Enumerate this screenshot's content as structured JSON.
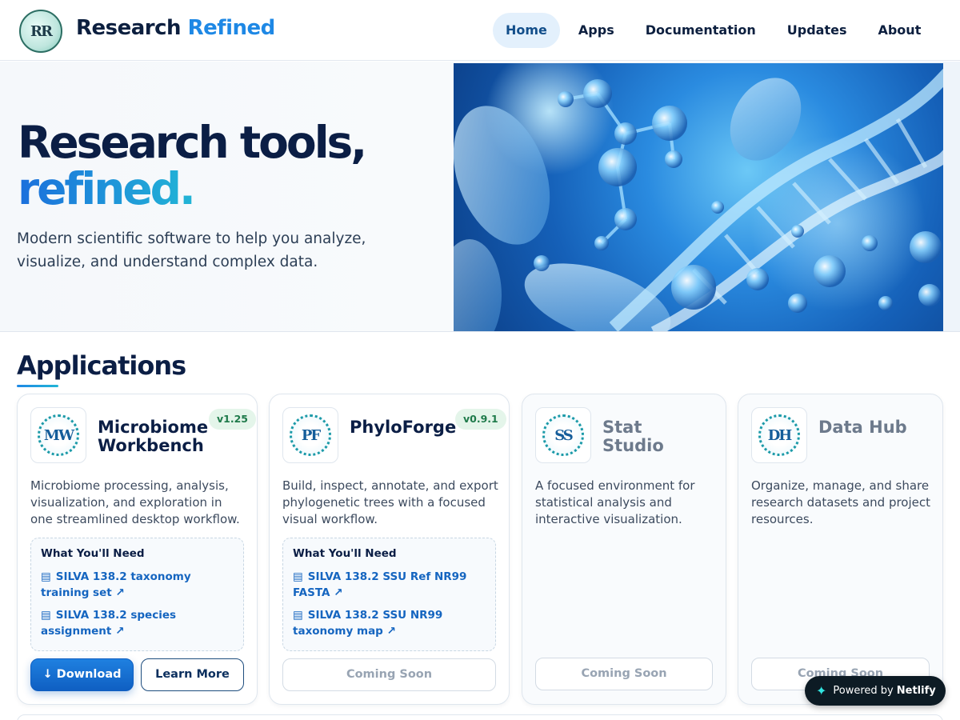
{
  "header": {
    "logo_text": "RR",
    "brand_main": "Research",
    "brand_accent": "Refined",
    "nav": [
      {
        "label": "Home",
        "active": true
      },
      {
        "label": "Apps",
        "active": false
      },
      {
        "label": "Documentation",
        "active": false
      },
      {
        "label": "Updates",
        "active": false
      },
      {
        "label": "About",
        "active": false
      }
    ]
  },
  "hero": {
    "title_line1": "Research tools,",
    "title_line2": "refined.",
    "subtitle": "Modern scientific software to help you analyze, visualize, and understand complex data."
  },
  "applications": {
    "title": "Applications",
    "cards": [
      {
        "icon_text": "MW",
        "name": "Microbiome Workbench",
        "version": "v1.25",
        "description": "Microbiome processing, analysis, visualization, and exploration in one streamlined desktop workflow.",
        "needs_title": "What You'll Need",
        "needs": [
          "SILVA 138.2 taxonomy training set ↗",
          "SILVA 138.2 species assignment ↗"
        ],
        "download_label": "↓ Download",
        "learn_label": "Learn More"
      },
      {
        "icon_text": "PF",
        "name": "PhyloForge",
        "version": "v0.9.1",
        "description": "Build, inspect, annotate, and export phylogenetic trees with a focused visual workflow.",
        "needs_title": "What You'll Need",
        "needs": [
          "SILVA 138.2 SSU Ref NR99 FASTA ↗",
          "SILVA 138.2 SSU NR99 taxonomy map ↗"
        ],
        "status_label": "Coming Soon"
      },
      {
        "icon_text": "SS",
        "name": "Stat Studio",
        "description": "A focused environment for statistical analysis and interactive visualization.",
        "status_label": "Coming Soon"
      },
      {
        "icon_text": "DH",
        "name": "Data Hub",
        "description": "Organize, manage, and share research datasets and project resources.",
        "status_label": "Coming Soon"
      }
    ]
  },
  "netlify_badge": {
    "prefix": "Powered by",
    "brand": "Netlify",
    "icon": "sparkle-icon"
  },
  "colors": {
    "accent": "#1e88e5",
    "primary_button": "#1565c0",
    "version_badge_bg": "#e4f5ea",
    "version_badge_text": "#1e7a4a",
    "heading": "#0b1e45"
  }
}
